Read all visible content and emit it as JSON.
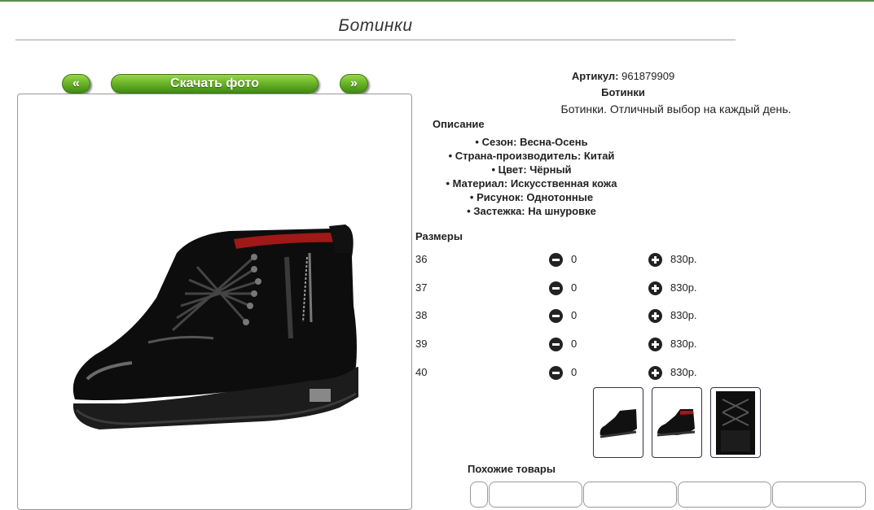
{
  "page": {
    "title": "Ботинки"
  },
  "gallery": {
    "prev_label": "«",
    "download_label": "Скачать фото",
    "next_label": "»"
  },
  "product": {
    "sku_label": "Артикул:",
    "sku_value": "961879909",
    "name": "Ботинки",
    "description": "Ботинки. Отличный выбор на каждый день.",
    "description_heading": "Описание",
    "attributes": [
      "Сезон: Весна-Осень",
      "Страна-производитель: Китай",
      "Цвет: Чёрный",
      "Материал: Искусственная кожа",
      "Рисунок: Однотонные",
      "Застежка: На шнуровке"
    ]
  },
  "sizes": {
    "heading": "Размеры",
    "rows": [
      {
        "size": "36",
        "qty": "0",
        "price": "830р."
      },
      {
        "size": "37",
        "qty": "0",
        "price": "830р."
      },
      {
        "size": "38",
        "qty": "0",
        "price": "830р."
      },
      {
        "size": "39",
        "qty": "0",
        "price": "830р."
      },
      {
        "size": "40",
        "qty": "0",
        "price": "830р."
      }
    ]
  },
  "similar": {
    "heading": "Похожие товары"
  },
  "colors": {
    "accent_green": "#6cb52a",
    "dark": "#222222"
  }
}
